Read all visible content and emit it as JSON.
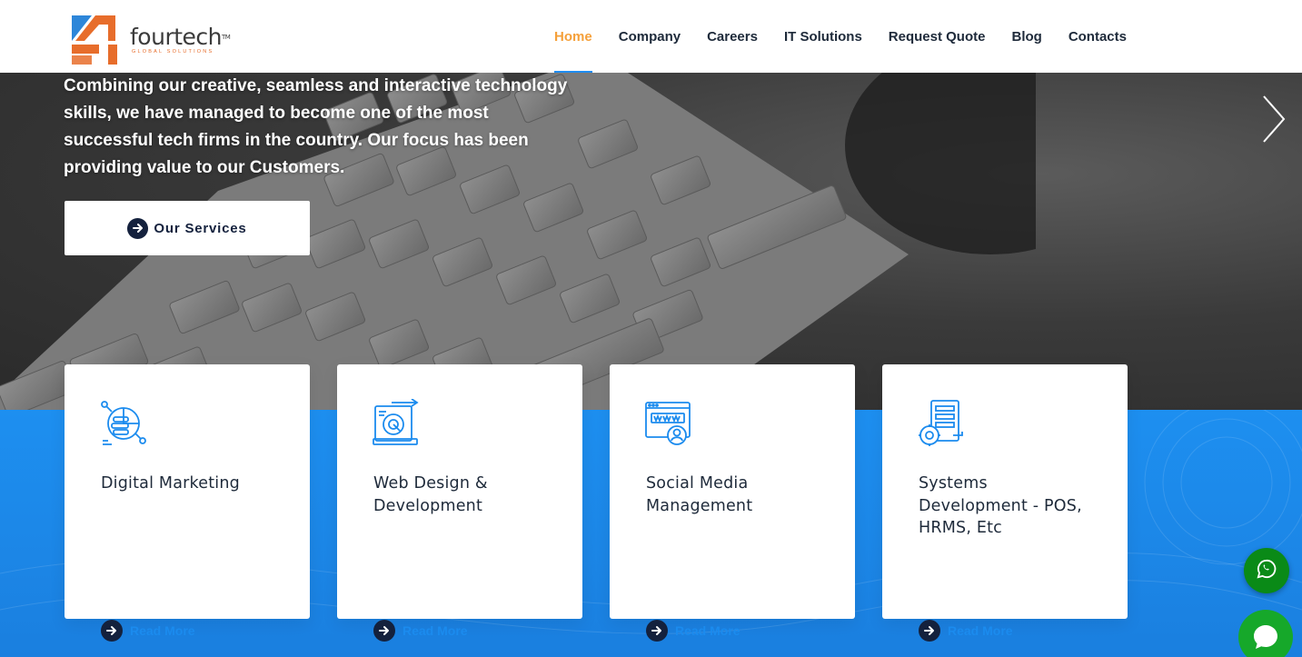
{
  "brand": {
    "name": "fourtech",
    "trademark": "TM",
    "tagline": "GLOBAL SOLUTIONS",
    "colors": {
      "orange": "#e76d2b",
      "blue": "#2d86d9",
      "dark": "#3b3b3b"
    }
  },
  "nav": {
    "items": [
      {
        "label": "Home",
        "active": true
      },
      {
        "label": "Company"
      },
      {
        "label": "Careers"
      },
      {
        "label": "IT Solutions"
      },
      {
        "label": "Request Quote"
      },
      {
        "label": "Blog"
      },
      {
        "label": "Contacts"
      }
    ],
    "active_color": "#f5a03a",
    "indicator_color": "#1f8df0"
  },
  "hero": {
    "lines": [
      "Combining our creative, seamless and interactive technology",
      "skills, we have managed to become one of the most",
      "successful tech firms in the country. Our focus has been",
      "providing value to our Customers."
    ],
    "button_label": "Our Services",
    "button_icon": "arrow-right-icon",
    "next_icon": "chevron-right-icon"
  },
  "services": [
    {
      "title": "Digital Marketing",
      "icon": "digital-marketing-icon",
      "read_more": "Read More"
    },
    {
      "title": "Web Design & Development",
      "icon": "web-design-icon",
      "read_more": "Read More"
    },
    {
      "title": "Social Media Management",
      "icon": "social-media-icon",
      "read_more": "Read More"
    },
    {
      "title": "Systems Development - POS, HRMS, Etc",
      "icon": "systems-development-icon",
      "read_more": "Read More"
    }
  ],
  "floating": {
    "whatsapp_icon": "whatsapp-icon",
    "chat_icon": "chat-bubble-icon",
    "whatsapp_color": "#0a8a17",
    "chat_color": "#16a82a"
  },
  "accent": {
    "section_blue": "#1d8ff0",
    "icon_blue": "#1b8bee"
  }
}
